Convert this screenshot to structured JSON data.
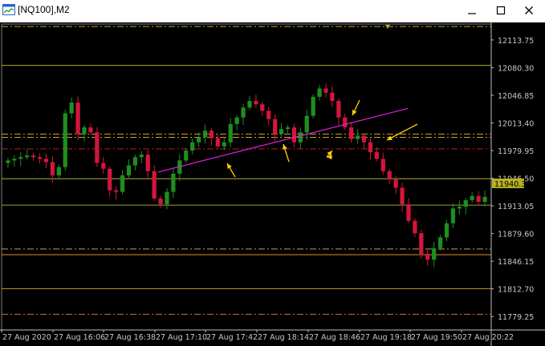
{
  "window": {
    "title": "[NQ100],M2",
    "icons": [
      "chart-app-icon",
      "minimize-icon",
      "maximize-icon",
      "close-icon"
    ]
  },
  "chart_data": {
    "type": "candlestick",
    "symbol": "NQ100",
    "timeframe": "M2",
    "background": "#000000",
    "up_color": "#1e8f1e",
    "down_color": "#d4163c",
    "y_ticks": [
      "12113.75",
      "12080.30",
      "12046.85",
      "12013.40",
      "11979.95",
      "11946.50",
      "11913.05",
      "11879.60",
      "11846.15",
      "11812.70",
      "11779.25"
    ],
    "y_tick_values": [
      12113.75,
      12080.3,
      12046.85,
      12013.4,
      11979.95,
      11946.5,
      11913.05,
      11879.6,
      11846.15,
      11812.7,
      11779.25
    ],
    "ylim": [
      11763,
      12133
    ],
    "current_price": "11940.32",
    "x_ticks": [
      "27 Aug 2020",
      "27 Aug 16:06",
      "27 Aug 16:38",
      "27 Aug 17:10",
      "27 Aug 17:42",
      "27 Aug 18:14",
      "27 Aug 18:46",
      "27 Aug 19:18",
      "27 Aug 19:50",
      "27 Aug 20:22"
    ],
    "horizontal_levels": [
      {
        "price": 12130,
        "style": "dashdot",
        "color": "#c8a040"
      },
      {
        "price": 12083,
        "style": "solid",
        "color": "#b8b020"
      },
      {
        "price": 12000,
        "style": "dashdot",
        "color": "#c8a040"
      },
      {
        "price": 11996,
        "style": "dashdot",
        "color": "#d0a020"
      },
      {
        "price": 11982,
        "style": "dashdot",
        "color": "#c01818"
      },
      {
        "price": 11946,
        "style": "solid",
        "color": "#b8b020"
      },
      {
        "price": 11914,
        "style": "solid",
        "color": "#9aa030"
      },
      {
        "price": 11861,
        "style": "dashdot",
        "color": "#c8a040"
      },
      {
        "price": 11854,
        "style": "solid",
        "color": "#e09020"
      },
      {
        "price": 11813,
        "style": "solid",
        "color": "#c8a020"
      },
      {
        "price": 11782,
        "style": "dashdot",
        "color": "#d07030"
      }
    ],
    "trendline": {
      "color": "#e020e0",
      "points": [
        [
          0.32,
          11954
        ],
        [
          0.83,
          12031
        ]
      ]
    },
    "arrows": {
      "color": "#ffd000",
      "count": 6
    },
    "candles": {
      "open": [
        11965,
        11968,
        11970,
        11972,
        11974,
        11972,
        11970,
        11966,
        11950,
        11960,
        12025,
        12038,
        12000,
        12008,
        12002,
        11965,
        11958,
        11932,
        11930,
        11950,
        11962,
        11972,
        11975,
        11955,
        11922,
        11915,
        11930,
        11952,
        11968,
        11980,
        11990,
        11996,
        12004,
        11995,
        11985,
        11990,
        12012,
        12020,
        12032,
        12040,
        12036,
        12028,
        12018,
        12000,
        12006,
        12008,
        11990,
        12002,
        12022,
        12045,
        12055,
        12050,
        12040,
        12020,
        12008,
        11994,
        11998,
        11990,
        11978,
        11970,
        11955,
        11945,
        11935,
        11915,
        11895,
        11880,
        11855,
        11848,
        11862,
        11875,
        11892,
        11910,
        11912,
        11920,
        11925,
        11918
      ],
      "close": [
        11968,
        11970,
        11972,
        11974,
        11972,
        11970,
        11966,
        11950,
        11960,
        12025,
        12038,
        12000,
        12008,
        12002,
        11965,
        11958,
        11932,
        11930,
        11950,
        11962,
        11972,
        11975,
        11955,
        11922,
        11915,
        11930,
        11952,
        11968,
        11980,
        11990,
        11996,
        12004,
        11995,
        11985,
        11990,
        12012,
        12020,
        12032,
        12040,
        12036,
        12028,
        12018,
        12000,
        12006,
        12008,
        11990,
        12002,
        12022,
        12045,
        12055,
        12050,
        12040,
        12020,
        12008,
        11994,
        11998,
        11990,
        11978,
        11970,
        11955,
        11945,
        11935,
        11915,
        11895,
        11880,
        11855,
        11848,
        11862,
        11875,
        11892,
        11910,
        11912,
        11920,
        11925,
        11918,
        11924
      ]
    }
  }
}
